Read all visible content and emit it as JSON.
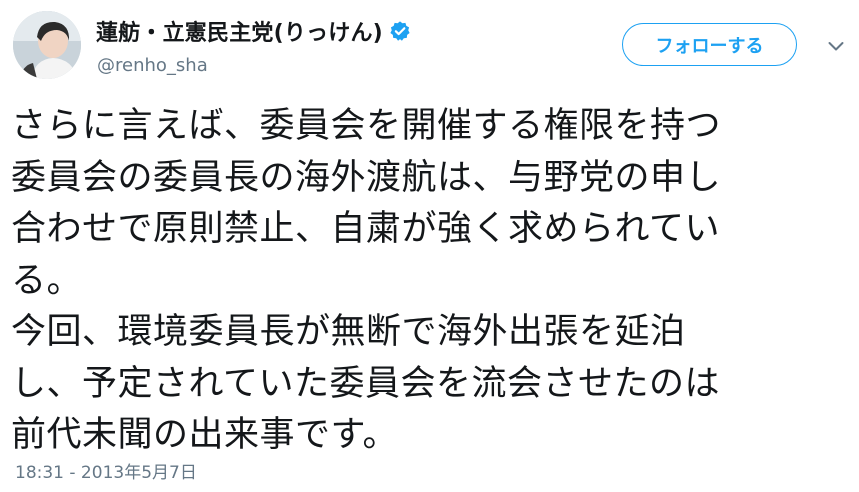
{
  "tweet": {
    "author": {
      "display_name": "蓮舫・立憲民主党(りっけん)",
      "handle": "@renho_sha",
      "verified": true
    },
    "follow_label": "フォローする",
    "text": "さらに言えば、委員会を開催する権限を持つ\n委員会の委員長の海外渡航は、与野党の申し\n合わせで原則禁止、自粛が強く求められてい\nる。\n今回、環境委員長が無断で海外出張を延泊\nし、予定されていた委員会を流会させたのは\n前代未聞の出来事です。",
    "timestamp": "18:31 - 2013年5月7日"
  },
  "icons": {
    "verified": "verified-badge-icon",
    "caret": "chevron-down-icon"
  },
  "colors": {
    "accent": "#1da1f2",
    "text": "#14171a",
    "secondary_text": "#657786"
  }
}
